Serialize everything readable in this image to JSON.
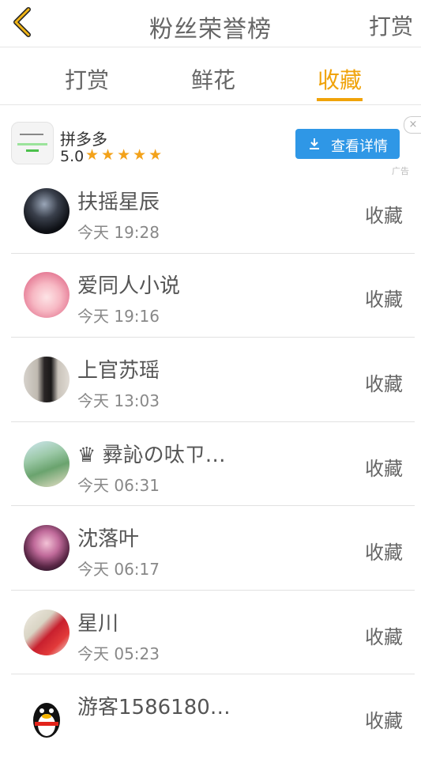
{
  "header": {
    "title": "粉丝荣誉榜",
    "right_action": "打赏"
  },
  "tabs": [
    {
      "label": "打赏"
    },
    {
      "label": "鲜花"
    },
    {
      "label": "收藏"
    }
  ],
  "ad": {
    "app_name": "拼多多",
    "rating": "5.0",
    "stars": "★★★★★",
    "button_label": "查看详情",
    "close_label": "×",
    "tag": "广告"
  },
  "fans": [
    {
      "name": "扶摇星辰",
      "time": "今天 19:28",
      "action": "收藏"
    },
    {
      "name": "爱同人小说",
      "time": "今天 19:16",
      "action": "收藏"
    },
    {
      "name": "上官苏瑶",
      "time": "今天 13:03",
      "action": "收藏"
    },
    {
      "name": "♛ 彛訫の呔ㄗ…",
      "time": "今天 06:31",
      "action": "收藏"
    },
    {
      "name": "沈落叶",
      "time": "今天 06:17",
      "action": "收藏"
    },
    {
      "name": "星川",
      "time": "今天 05:23",
      "action": "收藏"
    },
    {
      "name": "游客1586180…",
      "time": "",
      "action": "收藏"
    }
  ],
  "colors": {
    "accent": "#f0a30a",
    "ad_button": "#2f97e6",
    "star": "#f3a21a"
  }
}
